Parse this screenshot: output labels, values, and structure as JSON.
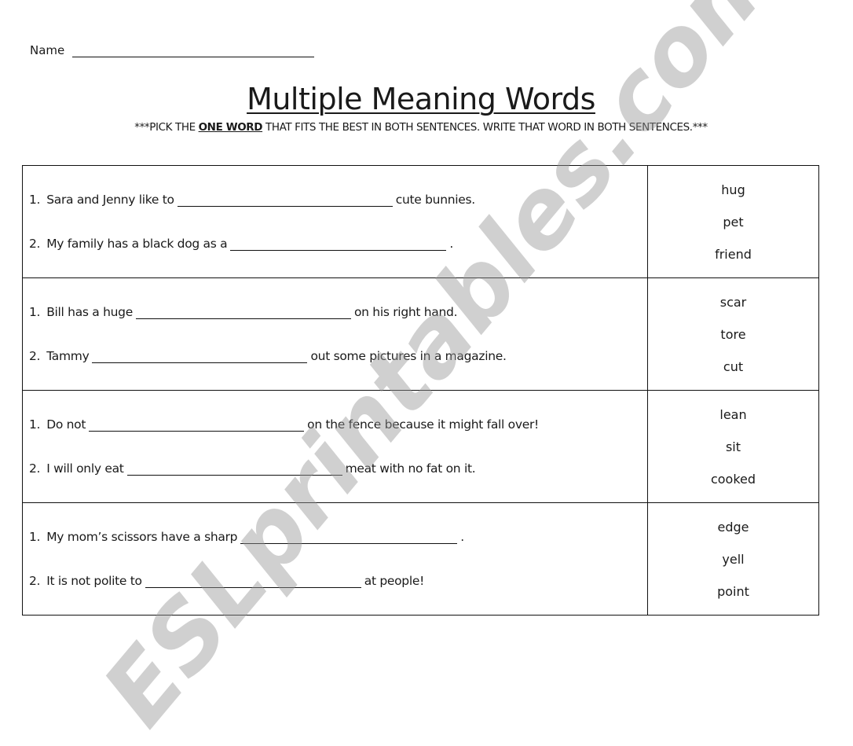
{
  "header": {
    "name_label": "Name",
    "title": "Multiple Meaning Words",
    "instructions_prefix": "***PICK THE ",
    "instructions_emphasis": "ONE WORD",
    "instructions_suffix": " THAT FITS THE BEST IN BOTH SENTENCES.  WRITE THAT WORD IN BOTH SENTENCES.***"
  },
  "questions": [
    {
      "sentences": [
        {
          "num": "1.",
          "before": "Sara and Jenny like to",
          "after": "cute bunnies."
        },
        {
          "num": "2.",
          "before": "My family has a black dog as a",
          "after": "."
        }
      ],
      "choices": [
        "hug",
        "pet",
        "friend"
      ]
    },
    {
      "sentences": [
        {
          "num": "1.",
          "before": "Bill has a huge",
          "after": "on his right hand."
        },
        {
          "num": "2.",
          "before": "Tammy",
          "after": "out some pictures in a magazine."
        }
      ],
      "choices": [
        "scar",
        "tore",
        "cut"
      ]
    },
    {
      "sentences": [
        {
          "num": "1.",
          "before": "Do not",
          "after": "on the fence because it might fall over!"
        },
        {
          "num": "2.",
          "before": "I will only eat",
          "after": "meat with no fat on it."
        }
      ],
      "choices": [
        "lean",
        "sit",
        "cooked"
      ]
    },
    {
      "sentences": [
        {
          "num": "1.",
          "before": "My mom’s scissors have a sharp",
          "after": "."
        },
        {
          "num": "2.",
          "before": "It is not polite to",
          "after": "at people!"
        }
      ],
      "choices": [
        "edge",
        "yell",
        "point"
      ]
    }
  ],
  "watermark": "ESLprintables.com"
}
